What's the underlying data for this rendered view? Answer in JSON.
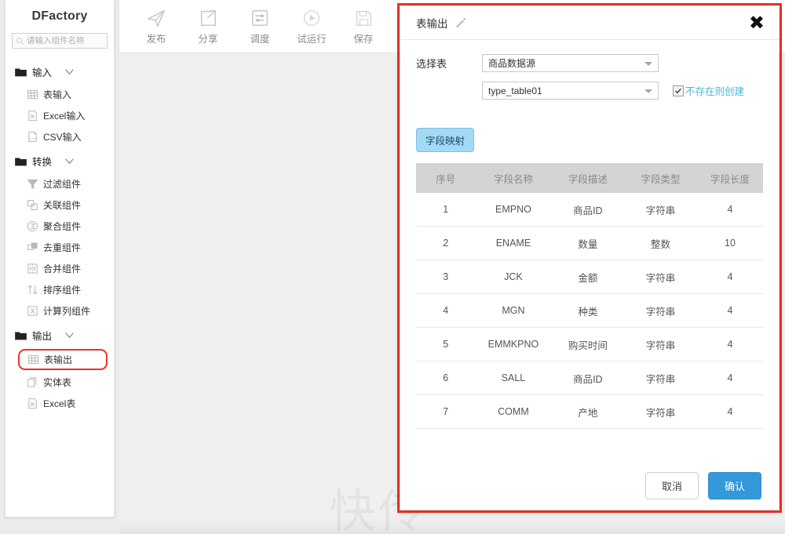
{
  "app": {
    "brand": "DFactory"
  },
  "search": {
    "placeholder": "请输入组件名称",
    "value": "",
    "icon": "search-icon"
  },
  "sidebar": {
    "groups": [
      {
        "label": "输入",
        "icon": "folder-icon",
        "chevron": "chevron-down-icon",
        "items": [
          {
            "label": "表输入",
            "icon": "table-icon",
            "highlighted": false
          },
          {
            "label": "Excel输入",
            "icon": "excel-icon",
            "highlighted": false
          },
          {
            "label": "CSV输入",
            "icon": "csv-icon",
            "highlighted": false
          }
        ]
      },
      {
        "label": "转换",
        "icon": "folder-icon",
        "chevron": "chevron-down-icon",
        "items": [
          {
            "label": "过滤组件",
            "icon": "filter-icon",
            "highlighted": false
          },
          {
            "label": "关联组件",
            "icon": "join-icon",
            "highlighted": false
          },
          {
            "label": "聚合组件",
            "icon": "aggregate-icon",
            "highlighted": false
          },
          {
            "label": "去重组件",
            "icon": "dedupe-icon",
            "highlighted": false
          },
          {
            "label": "合并组件",
            "icon": "merge-icon",
            "highlighted": false
          },
          {
            "label": "排序组件",
            "icon": "sort-icon",
            "highlighted": false
          },
          {
            "label": "计算列组件",
            "icon": "formula-icon",
            "highlighted": false
          }
        ]
      },
      {
        "label": "输出",
        "icon": "folder-icon",
        "chevron": "chevron-down-icon",
        "items": [
          {
            "label": "表输出",
            "icon": "table-icon",
            "highlighted": true
          },
          {
            "label": "实体表",
            "icon": "entity-table-icon",
            "highlighted": false
          },
          {
            "label": "Excel表",
            "icon": "excel-icon",
            "highlighted": false
          }
        ]
      }
    ]
  },
  "toolbar": {
    "items": [
      {
        "label": "发布",
        "icon": "paper-plane-icon"
      },
      {
        "label": "分享",
        "icon": "share-icon"
      },
      {
        "label": "调度",
        "icon": "sliders-icon"
      },
      {
        "label": "试运行",
        "icon": "play-circle-icon"
      },
      {
        "label": "保存",
        "icon": "floppy-disk-icon"
      }
    ]
  },
  "dialog": {
    "title": "表输出",
    "edit_icon": "pencil-icon",
    "close_icon": "close-icon",
    "select_label": "选择表",
    "datasource": {
      "value": "商品数据源",
      "caret_icon": "chevron-down-icon"
    },
    "table": {
      "value": "type_table01",
      "caret_icon": "chevron-down-icon"
    },
    "create_if_absent": {
      "label": "不存在则创建",
      "checked": true,
      "color": "#46b8d8"
    },
    "mapping_button": "字段映射",
    "field_table": {
      "headers": [
        "序号",
        "字段名称",
        "字段描述",
        "字段类型",
        "字段长度"
      ],
      "rows": [
        [
          "1",
          "EMPNO",
          "商品ID",
          "字符串",
          "4"
        ],
        [
          "2",
          "ENAME",
          "数量",
          "整数",
          "10"
        ],
        [
          "3",
          "JCK",
          "金额",
          "字符串",
          "4"
        ],
        [
          "4",
          "MGN",
          "种类",
          "字符串",
          "4"
        ],
        [
          "5",
          "EMMKPNO",
          "购买时间",
          "字符串",
          "4"
        ],
        [
          "6",
          "SALL",
          "商品ID",
          "字符串",
          "4"
        ],
        [
          "7",
          "COMM",
          "产地",
          "字符串",
          "4"
        ]
      ]
    },
    "cancel_button": "取消",
    "confirm_button": "确认"
  },
  "watermark": {
    "text": "快传"
  },
  "colors": {
    "accent": "#3498db",
    "highlight": "#e8332a",
    "link": "#46b8d8",
    "map_button": "#a4d9f5"
  }
}
